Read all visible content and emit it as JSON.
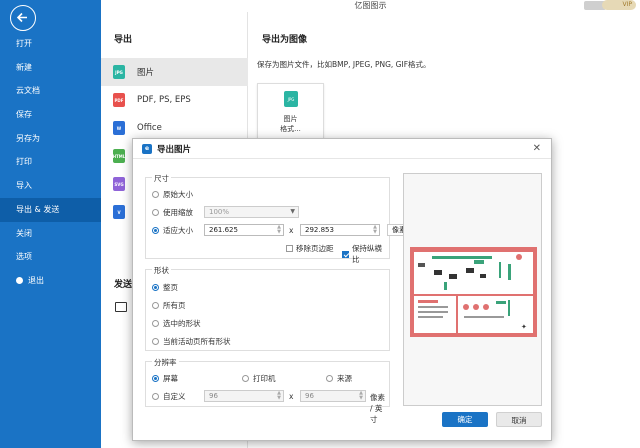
{
  "app": {
    "title": "亿图图示",
    "vip_label": "VIP"
  },
  "sidebar": {
    "items": [
      {
        "label": "打开"
      },
      {
        "label": "新建"
      },
      {
        "label": "云文档"
      },
      {
        "label": "保存"
      },
      {
        "label": "另存为"
      },
      {
        "label": "打印"
      },
      {
        "label": "导入"
      },
      {
        "label": "导出 & 发送",
        "active": true
      },
      {
        "label": "关闭"
      },
      {
        "label": "选项"
      },
      {
        "label": "退出"
      }
    ]
  },
  "export_panel": {
    "title": "导出",
    "formats": [
      {
        "icon": "jpg-icon",
        "icon_text": "JPG",
        "color": "#2bb5a3",
        "label": "图片",
        "active": true
      },
      {
        "icon": "pdf-icon",
        "icon_text": "PDF",
        "color": "#e8514d",
        "label": "PDF, PS, EPS"
      },
      {
        "icon": "word-icon",
        "icon_text": "W",
        "color": "#2b6fd6",
        "label": "Office"
      },
      {
        "icon": "html-icon",
        "icon_text": "HTML",
        "color": "#4caf50",
        "label": ""
      },
      {
        "icon": "svg-icon",
        "icon_text": "SVG",
        "color": "#8f63d8",
        "label": ""
      },
      {
        "icon": "visio-icon",
        "icon_text": "V",
        "color": "#2b6fd6",
        "label": ""
      }
    ],
    "send_title": "发送"
  },
  "image_panel": {
    "title": "导出为图像",
    "description": "保存为图片文件，比如BMP, JPEG, PNG, GIF格式。",
    "card_icon_text": "JPG",
    "card_label_line1": "图片",
    "card_label_line2": "格式..."
  },
  "dialog": {
    "title": "导出图片",
    "size": {
      "label": "尺寸",
      "original": "原始大小",
      "use_zoom": "使用缩放",
      "zoom_value": "100%",
      "fit_size": "适应大小",
      "width": "261.625",
      "height": "292.853",
      "unit": "像素",
      "remove_margin": "移除页边距",
      "keep_ratio": "保持纵横比"
    },
    "shape": {
      "label": "形状",
      "whole_page": "整页",
      "all_pages": "所有页",
      "selected_shapes": "选中的形状",
      "current_page_all": "当前活动页所有形状"
    },
    "resolution": {
      "label": "分辨率",
      "screen": "屏幕",
      "printer": "打印机",
      "source": "来源",
      "custom": "自定义",
      "x_value": "96",
      "y_value": "96",
      "times": "x",
      "unit": "像素 / 英寸"
    },
    "ok": "确定",
    "cancel": "取消"
  }
}
